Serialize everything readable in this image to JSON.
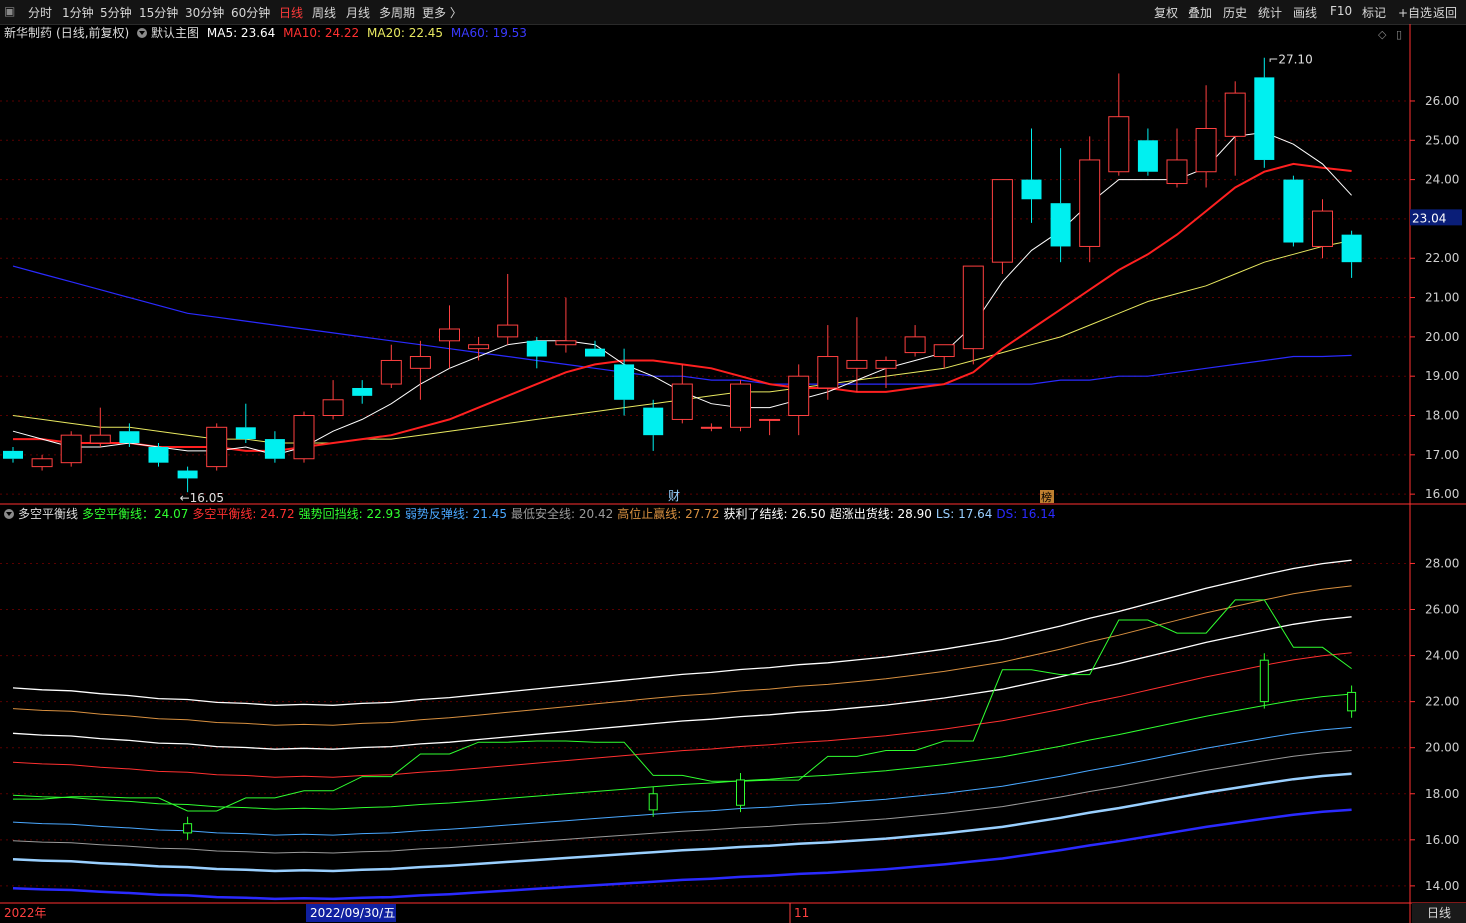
{
  "toolbar": {
    "periods": [
      "分时",
      "1分钟",
      "5分钟",
      "15分钟",
      "30分钟",
      "60分钟",
      "日线",
      "周线",
      "月线",
      "多周期",
      "更多 〉"
    ],
    "active_period": "日线",
    "right_buttons": [
      "复权",
      "叠加",
      "历史",
      "统计",
      "画线",
      "F10",
      "标记",
      "+自选",
      "返回"
    ]
  },
  "main_info": {
    "stock": "新华制药",
    "mode": "(日线,前复权)",
    "template": "默认主图",
    "ma5": "MA5: 23.64",
    "ma10": "MA10: 24.22",
    "ma20": "MA20: 22.45",
    "ma60": "MA60: 19.53"
  },
  "colors": {
    "ma5": "#ffffff",
    "ma10": "#ff2020",
    "ma20": "#e8e860",
    "ma60": "#2a2aff",
    "up": "#ff4040",
    "down": "#00f0f0",
    "grid": "#5a0000",
    "axis": "#ff3030"
  },
  "chart_data": {
    "type": "candlestick",
    "candles": [
      [
        17.1,
        17.2,
        16.8,
        16.9
      ],
      [
        16.7,
        17.0,
        16.6,
        16.9
      ],
      [
        16.8,
        17.6,
        16.7,
        17.5
      ],
      [
        17.3,
        18.2,
        17.2,
        17.5
      ],
      [
        17.6,
        17.8,
        17.2,
        17.3
      ],
      [
        17.2,
        17.3,
        16.7,
        16.8
      ],
      [
        16.6,
        16.7,
        16.05,
        16.4
      ],
      [
        16.7,
        17.8,
        16.6,
        17.7
      ],
      [
        17.7,
        18.3,
        17.3,
        17.4
      ],
      [
        17.4,
        17.6,
        16.8,
        16.9
      ],
      [
        16.9,
        18.1,
        16.8,
        18.0
      ],
      [
        18.0,
        18.9,
        17.9,
        18.4
      ],
      [
        18.7,
        18.9,
        18.3,
        18.5
      ],
      [
        18.8,
        19.8,
        18.7,
        19.4
      ],
      [
        19.2,
        19.9,
        18.4,
        19.5
      ],
      [
        19.9,
        20.8,
        19.2,
        20.2
      ],
      [
        19.7,
        20.0,
        19.4,
        19.8
      ],
      [
        20.0,
        21.6,
        19.8,
        20.3
      ],
      [
        19.9,
        20.0,
        19.2,
        19.5
      ],
      [
        19.8,
        21.0,
        19.6,
        19.9
      ],
      [
        19.7,
        19.9,
        19.5,
        19.5
      ],
      [
        19.3,
        19.7,
        18.0,
        18.4
      ],
      [
        18.2,
        18.4,
        17.1,
        17.5
      ],
      [
        17.9,
        19.3,
        17.8,
        18.8
      ],
      [
        17.7,
        17.8,
        17.6,
        17.7
      ],
      [
        17.7,
        18.9,
        17.6,
        18.8
      ],
      [
        17.9,
        17.9,
        17.5,
        17.9
      ],
      [
        18.0,
        19.3,
        17.5,
        19.0
      ],
      [
        18.7,
        20.3,
        18.4,
        19.5
      ],
      [
        19.2,
        20.5,
        18.6,
        19.4
      ],
      [
        19.2,
        19.5,
        18.7,
        19.4
      ],
      [
        19.6,
        20.3,
        19.5,
        20.0
      ],
      [
        19.5,
        19.7,
        19.2,
        19.8
      ],
      [
        19.7,
        21.8,
        19.3,
        21.8
      ],
      [
        21.9,
        24.0,
        21.6,
        24.0
      ],
      [
        24.0,
        25.3,
        22.9,
        23.5
      ],
      [
        23.4,
        24.8,
        21.9,
        22.3
      ],
      [
        22.3,
        25.1,
        21.9,
        24.5
      ],
      [
        24.2,
        26.7,
        24.1,
        25.6
      ],
      [
        25.0,
        25.3,
        24.1,
        24.2
      ],
      [
        23.9,
        25.3,
        23.8,
        24.5
      ],
      [
        24.2,
        26.4,
        23.8,
        25.3
      ],
      [
        25.1,
        26.5,
        24.1,
        26.2
      ],
      [
        26.6,
        27.1,
        24.3,
        24.5
      ],
      [
        24.0,
        24.1,
        22.3,
        22.4
      ],
      [
        22.3,
        23.5,
        22.0,
        23.2
      ],
      [
        22.6,
        22.7,
        21.5,
        21.9
      ]
    ],
    "ma5": [
      17.6,
      17.4,
      17.2,
      17.2,
      17.3,
      17.2,
      17.1,
      17.1,
      17.2,
      17.0,
      17.2,
      17.6,
      17.9,
      18.3,
      18.8,
      19.2,
      19.5,
      19.8,
      19.9,
      19.9,
      19.8,
      19.3,
      19.0,
      18.6,
      18.3,
      18.2,
      18.2,
      18.4,
      18.6,
      18.9,
      19.2,
      19.4,
      19.6,
      20.3,
      21.4,
      22.2,
      22.7,
      23.4,
      24.0,
      24.0,
      24.0,
      24.3,
      25.1,
      25.2,
      24.9,
      24.4,
      23.6
    ],
    "ma10": [
      17.4,
      17.4,
      17.3,
      17.3,
      17.3,
      17.2,
      17.2,
      17.2,
      17.1,
      17.1,
      17.2,
      17.3,
      17.4,
      17.5,
      17.7,
      17.9,
      18.2,
      18.5,
      18.8,
      19.1,
      19.3,
      19.4,
      19.4,
      19.3,
      19.2,
      19.0,
      18.8,
      18.7,
      18.7,
      18.6,
      18.6,
      18.7,
      18.8,
      19.1,
      19.7,
      20.2,
      20.7,
      21.2,
      21.7,
      22.1,
      22.6,
      23.2,
      23.8,
      24.2,
      24.4,
      24.3,
      24.22
    ],
    "ma20": [
      18.0,
      17.9,
      17.8,
      17.7,
      17.7,
      17.6,
      17.5,
      17.4,
      17.4,
      17.3,
      17.3,
      17.3,
      17.4,
      17.4,
      17.5,
      17.6,
      17.7,
      17.8,
      17.9,
      18.0,
      18.1,
      18.2,
      18.3,
      18.4,
      18.5,
      18.6,
      18.6,
      18.7,
      18.8,
      18.9,
      19.0,
      19.1,
      19.2,
      19.4,
      19.6,
      19.8,
      20.0,
      20.3,
      20.6,
      20.9,
      21.1,
      21.3,
      21.6,
      21.9,
      22.1,
      22.3,
      22.45
    ],
    "ma60": [
      21.8,
      21.6,
      21.4,
      21.2,
      21.0,
      20.8,
      20.6,
      20.5,
      20.4,
      20.3,
      20.2,
      20.1,
      20.0,
      19.9,
      19.8,
      19.7,
      19.6,
      19.5,
      19.4,
      19.3,
      19.2,
      19.1,
      19.0,
      19.0,
      18.9,
      18.9,
      18.8,
      18.8,
      18.8,
      18.8,
      18.8,
      18.8,
      18.8,
      18.8,
      18.8,
      18.8,
      18.9,
      18.9,
      19.0,
      19.0,
      19.1,
      19.2,
      19.3,
      19.4,
      19.5,
      19.5,
      19.53
    ],
    "main_ylim": [
      15.8,
      27.5
    ],
    "main_ticks": [
      "16.00",
      "17.00",
      "18.00",
      "19.00",
      "20.00",
      "21.00",
      "22.00",
      "23.00",
      "24.00",
      "25.00",
      "26.00"
    ],
    "price_tag": "23.04",
    "high_label": "27.10",
    "low_label": "16.05",
    "event_markers": [
      "财",
      "榜"
    ],
    "indicator": {
      "title": "多空平衡线",
      "legend": [
        {
          "label": "多空平衡线：24.07",
          "color": "#30ff30"
        },
        {
          "label": "多空平衡线: 24.72",
          "color": "#ff3030"
        },
        {
          "label": "强势回挡线: 22.93",
          "color": "#30ff30"
        },
        {
          "label": "弱势反弹线: 21.45",
          "color": "#4aa8ff"
        },
        {
          "label": "最低安全线: 20.42",
          "color": "#9a9a9a"
        },
        {
          "label": "高位止赢线: 27.72",
          "color": "#d89040"
        },
        {
          "label": "获利了结线: 26.50",
          "color": "#ffffff"
        },
        {
          "label": "超涨出货线: 28.90",
          "color": "#ffffff"
        },
        {
          "label": "LS: 17.64",
          "color": "#9ad0ff"
        },
        {
          "label": "DS: 16.14",
          "color": "#2a2aff"
        }
      ],
      "ylim": [
        13.3,
        29.8
      ],
      "ticks": [
        "14.00",
        "16.00",
        "18.00",
        "20.00",
        "22.00",
        "24.00",
        "26.00",
        "28.00"
      ]
    },
    "x_labels": [
      "2022年",
      "2022/09/30/五",
      "11"
    ]
  },
  "bottom_right": "日线"
}
